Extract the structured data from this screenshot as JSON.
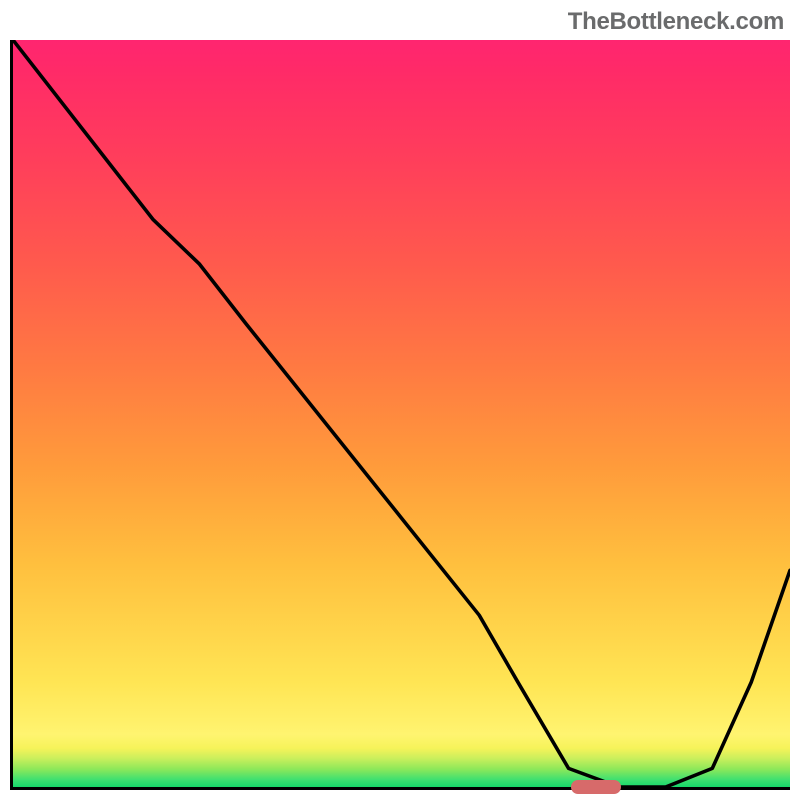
{
  "watermark": "TheBottleneck.com",
  "chart_data": {
    "type": "line",
    "title": "",
    "xlabel": "",
    "ylabel": "",
    "xlim": [
      0,
      100
    ],
    "ylim": [
      0,
      100
    ],
    "series": [
      {
        "name": "curve",
        "x": [
          0,
          9,
          18,
          24,
          30,
          40,
          50,
          60,
          65,
          71.5,
          78,
          84,
          90,
          95,
          100
        ],
        "values": [
          100,
          88,
          76,
          70,
          62,
          49,
          36,
          23,
          14,
          2.5,
          0,
          0,
          2.5,
          14,
          29
        ]
      }
    ],
    "marker": {
      "x_start": 71.5,
      "x_end": 78,
      "y": 0,
      "color": "#d76a6a"
    },
    "background_gradient": {
      "top": "#ff2570",
      "bottom": "#16d96a"
    }
  }
}
